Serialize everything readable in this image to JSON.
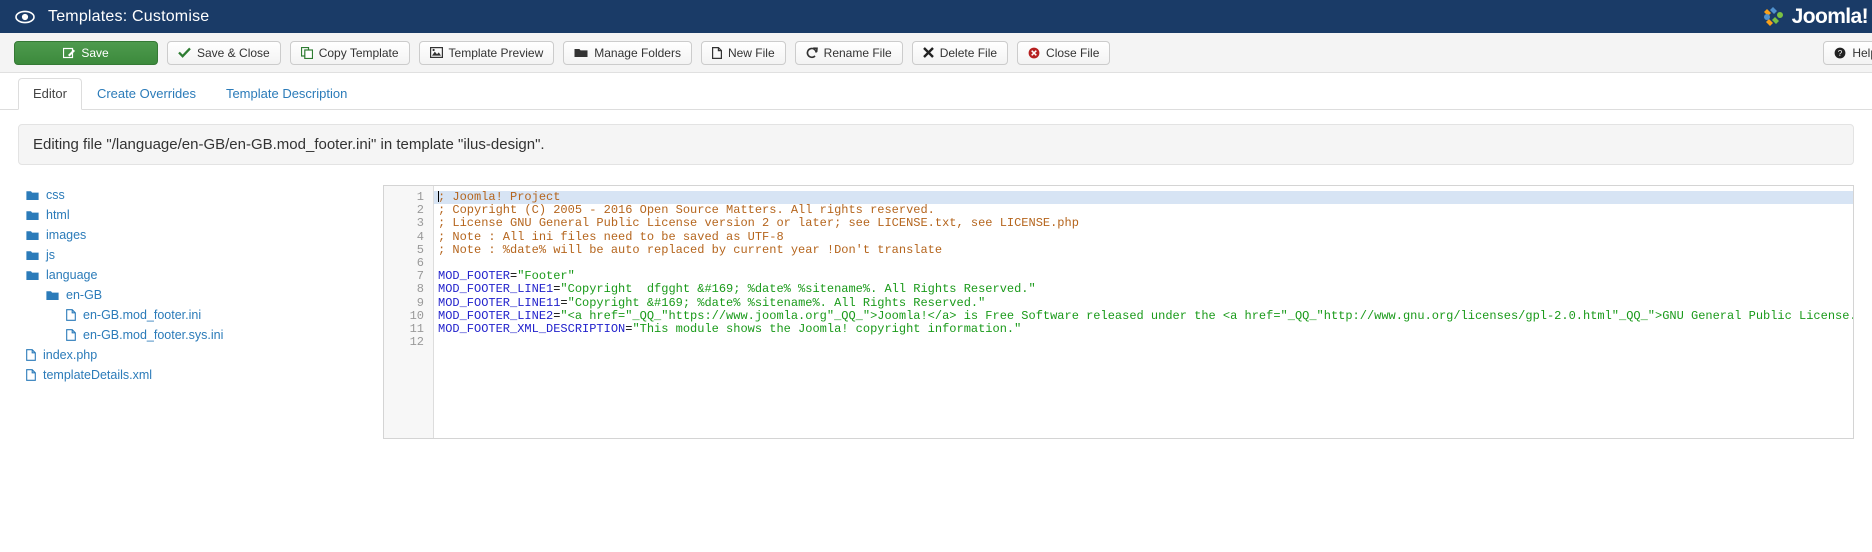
{
  "header": {
    "title": "Templates: Customise",
    "eye_icon": "eye-icon",
    "brand": "Joomla!"
  },
  "toolbar": {
    "buttons": [
      {
        "label": "Save",
        "icon": "save-pencil-icon",
        "style": "primary"
      },
      {
        "label": "Save & Close",
        "icon": "check-icon",
        "style": "default"
      },
      {
        "label": "Copy Template",
        "icon": "copy-icon",
        "style": "default"
      },
      {
        "label": "Template Preview",
        "icon": "image-icon",
        "style": "default"
      },
      {
        "label": "Manage Folders",
        "icon": "folder-open-icon",
        "style": "default"
      },
      {
        "label": "New File",
        "icon": "file-icon",
        "style": "default"
      },
      {
        "label": "Rename File",
        "icon": "refresh-icon",
        "style": "default"
      },
      {
        "label": "Delete File",
        "icon": "x-mark-icon",
        "style": "default"
      },
      {
        "label": "Close File",
        "icon": "cancel-circle-icon",
        "style": "default"
      }
    ],
    "help": {
      "label": "Help",
      "icon": "question-circle-icon"
    }
  },
  "tabs": [
    {
      "label": "Editor",
      "active": true
    },
    {
      "label": "Create Overrides",
      "active": false
    },
    {
      "label": "Template Description",
      "active": false
    }
  ],
  "heading": "Editing file \"/language/en-GB/en-GB.mod_footer.ini\" in template \"ilus-design\".",
  "filetree": [
    {
      "label": "css",
      "type": "folder",
      "depth": 1
    },
    {
      "label": "html",
      "type": "folder",
      "depth": 1
    },
    {
      "label": "images",
      "type": "folder",
      "depth": 1
    },
    {
      "label": "js",
      "type": "folder",
      "depth": 1
    },
    {
      "label": "language",
      "type": "folder",
      "depth": 1
    },
    {
      "label": "en-GB",
      "type": "folder",
      "depth": 2
    },
    {
      "label": "en-GB.mod_footer.ini",
      "type": "file",
      "depth": 3
    },
    {
      "label": "en-GB.mod_footer.sys.ini",
      "type": "file",
      "depth": 3
    },
    {
      "label": "index.php",
      "type": "file",
      "depth": 1
    },
    {
      "label": "templateDetails.xml",
      "type": "file",
      "depth": 1
    }
  ],
  "editor": {
    "line_numbers": [
      "1",
      "2",
      "3",
      "4",
      "5",
      "6",
      "7",
      "8",
      "9",
      "10",
      "11",
      "12"
    ],
    "current_line": 1,
    "lines": [
      {
        "n": 1,
        "segments": [
          {
            "t": "comment",
            "v": "; Joomla! Project"
          }
        ]
      },
      {
        "n": 2,
        "segments": [
          {
            "t": "comment",
            "v": "; Copyright (C) 2005 - 2016 Open Source Matters. All rights reserved."
          }
        ]
      },
      {
        "n": 3,
        "segments": [
          {
            "t": "comment",
            "v": "; License GNU General Public License version 2 or later; see LICENSE.txt, see LICENSE.php"
          }
        ]
      },
      {
        "n": 4,
        "segments": [
          {
            "t": "comment",
            "v": "; Note : All ini files need to be saved as UTF-8"
          }
        ]
      },
      {
        "n": 5,
        "segments": [
          {
            "t": "comment",
            "v": "; Note : %date% will be auto replaced by current year !Don't translate"
          }
        ]
      },
      {
        "n": 6,
        "segments": [
          {
            "t": "plain",
            "v": ""
          }
        ]
      },
      {
        "n": 7,
        "segments": [
          {
            "t": "key",
            "v": "MOD_FOOTER"
          },
          {
            "t": "op",
            "v": "="
          },
          {
            "t": "str",
            "v": "\"Footer\""
          }
        ]
      },
      {
        "n": 8,
        "segments": [
          {
            "t": "key",
            "v": "MOD_FOOTER_LINE1"
          },
          {
            "t": "op",
            "v": "="
          },
          {
            "t": "str",
            "v": "\"Copyright  dfgght &#169; %date% %sitename%. All Rights Reserved.\""
          }
        ]
      },
      {
        "n": 9,
        "segments": [
          {
            "t": "key",
            "v": "MOD_FOOTER_LINE11"
          },
          {
            "t": "op",
            "v": "="
          },
          {
            "t": "str",
            "v": "\"Copyright &#169; %date% %sitename%. All Rights Reserved.\""
          }
        ]
      },
      {
        "n": 10,
        "segments": [
          {
            "t": "key",
            "v": "MOD_FOOTER_LINE2"
          },
          {
            "t": "op",
            "v": "="
          },
          {
            "t": "str",
            "v": "\"<a href=\"_QQ_\"https://www.joomla.org\"_QQ_\">Joomla!</a> is Free Software released under the <a href=\"_QQ_\"http://www.gnu.org/licenses/gpl-2.0.html\"_QQ_\">GNU General Public License.</a>\""
          }
        ]
      },
      {
        "n": 11,
        "segments": [
          {
            "t": "key",
            "v": "MOD_FOOTER_XML_DESCRIPTION"
          },
          {
            "t": "op",
            "v": "="
          },
          {
            "t": "str",
            "v": "\"This module shows the Joomla! copyright information.\""
          }
        ]
      },
      {
        "n": 12,
        "segments": [
          {
            "t": "plain",
            "v": ""
          }
        ]
      }
    ]
  },
  "colors": {
    "header_bg": "#1a3b67",
    "primary_button": "#3c8a3c",
    "link": "#2b7bb9",
    "comment": "#b5651d",
    "key": "#2222cc",
    "string": "#1a9a1a",
    "current_line": "#d7e4f4"
  }
}
